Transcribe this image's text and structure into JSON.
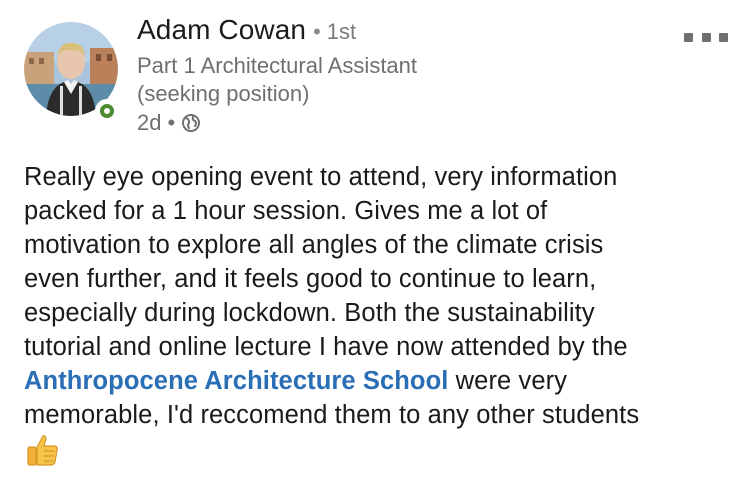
{
  "post": {
    "author": {
      "name": "Adam Cowan",
      "separator": "•",
      "degree": "1st",
      "headline_line1": "Part 1 Architectural Assistant",
      "headline_line2": "(seeking position)",
      "online_status": "online"
    },
    "meta": {
      "time": "2d",
      "separator": "•",
      "visibility_icon": "globe-icon"
    },
    "more_icon": "more-options-icon",
    "body": {
      "line1": "Really eye opening event to attend, very information",
      "line2": "packed for a 1 hour session. Gives me a lot of",
      "line3": "motivation to explore all angles of the climate crisis",
      "line4": "even further, and it feels good to continue to learn,",
      "line5": "especially during lockdown. Both the sustainability",
      "line6": "tutorial and online lecture I have now attended by the",
      "mention": "Anthropocene Architecture School",
      "after_mention": " were very",
      "line8": "memorable, I'd reccomend them to any other students",
      "emoji": "thumbs-up-emoji"
    },
    "colors": {
      "mention": "#2a6eb5",
      "presence": "#4b8a2e",
      "secondary_text": "#6f6f6f"
    }
  }
}
